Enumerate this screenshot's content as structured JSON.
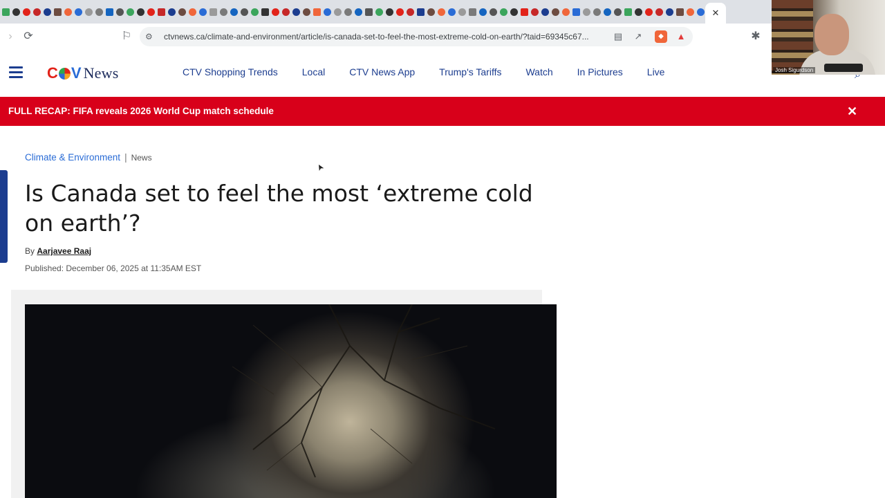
{
  "browser": {
    "active_tab_close": "✕",
    "url": "ctvnews.ca/climate-and-environment/article/is-canada-set-to-feel-the-most-extreme-cold-on-earth/?taid=69345c67...",
    "icons": [
      "forward-icon",
      "reload-icon",
      "bookmark-icon",
      "site-settings-icon",
      "reader-mode-icon",
      "share-icon",
      "brave-shields-icon",
      "brave-rewards-icon",
      "extensions-icon"
    ]
  },
  "site": {
    "logo": {
      "c": "C",
      "t": "T",
      "v": "V",
      "news": "News"
    },
    "nav": [
      "CTV Shopping Trends",
      "Local",
      "CTV News App",
      "Trump's Tariffs",
      "Watch",
      "In Pictures",
      "Live"
    ]
  },
  "banner": {
    "text": "FULL RECAP: FIFA reveals 2026 World Cup match schedule",
    "close": "✕"
  },
  "article": {
    "category": "Climate & Environment",
    "separator": "|",
    "type": "News",
    "headline": "Is Canada set to feel the most ‘extreme cold on earth’?",
    "by": "By",
    "author": "Aarjavee Raaj",
    "published": "Published: December 06, 2025 at 11:35AM EST"
  },
  "webcam": {
    "name": "Josh Sigurdson"
  },
  "colors": {
    "brand_blue": "#1c3d8f",
    "banner_red": "#d8001a",
    "link_blue": "#2a6cd6"
  }
}
